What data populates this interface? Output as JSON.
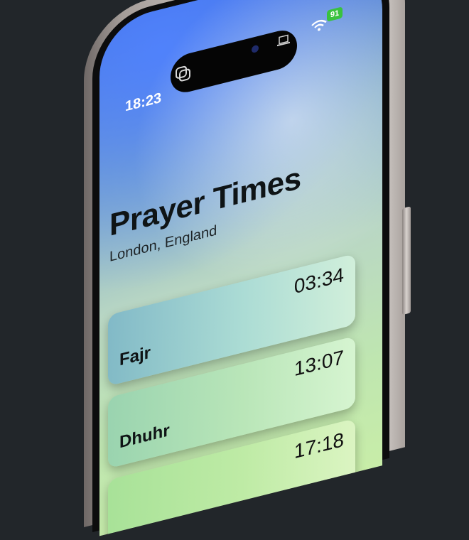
{
  "status_bar": {
    "time": "18:23",
    "battery": "91"
  },
  "header": {
    "title": "Prayer Times",
    "location": "London, England"
  },
  "prayers": [
    {
      "name": "Fajr",
      "time": "03:34"
    },
    {
      "name": "Dhuhr",
      "time": "13:07"
    },
    {
      "name": "",
      "time": "17:18"
    }
  ],
  "colors": {
    "background": "#22262a",
    "battery": "#39c23f"
  }
}
